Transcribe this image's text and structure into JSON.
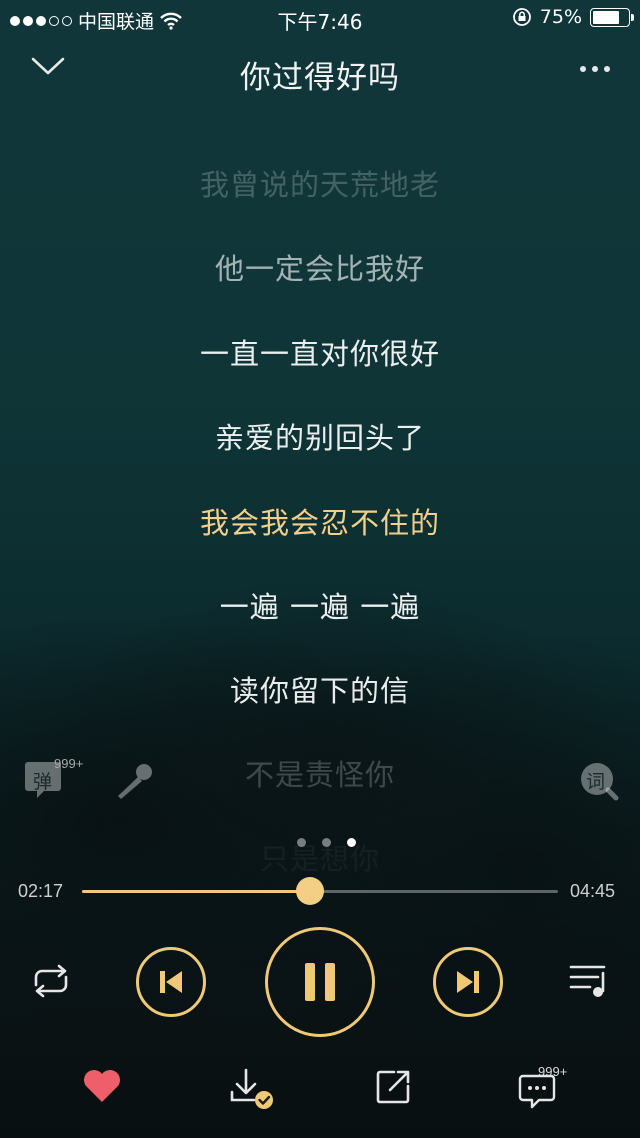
{
  "status_bar": {
    "carrier": "中国联通",
    "time": "下午7:46",
    "battery_percent": "75%",
    "battery_level": 0.75,
    "signal_bars": 3
  },
  "header": {
    "title": "你过得好吗"
  },
  "lyrics": [
    {
      "text": "我曾说的天荒地老",
      "state": "faded"
    },
    {
      "text": "他一定会比我好",
      "state": "dim"
    },
    {
      "text": "一直一直对你很好",
      "state": "normal"
    },
    {
      "text": "亲爱的别回头了",
      "state": "normal"
    },
    {
      "text": "我会我会忍不住的",
      "state": "current"
    },
    {
      "text": "一遍 一遍 一遍",
      "state": "normal"
    },
    {
      "text": "读你留下的信",
      "state": "normal"
    },
    {
      "text": "不是责怪你",
      "state": "faded"
    },
    {
      "text": "只是想你",
      "state": "hidden"
    }
  ],
  "side": {
    "danmu_label": "弹",
    "danmu_count": "999+",
    "lyrics_label": "词"
  },
  "pager": {
    "count": 3,
    "active_index": 2
  },
  "progress": {
    "current_time": "02:17",
    "total_time": "04:45",
    "fraction": 0.48
  },
  "bottom": {
    "comments_count": "999+"
  },
  "colors": {
    "accent": "#f0c977",
    "current_lyric": "#f0d08c",
    "like": "#ef5f6b"
  }
}
